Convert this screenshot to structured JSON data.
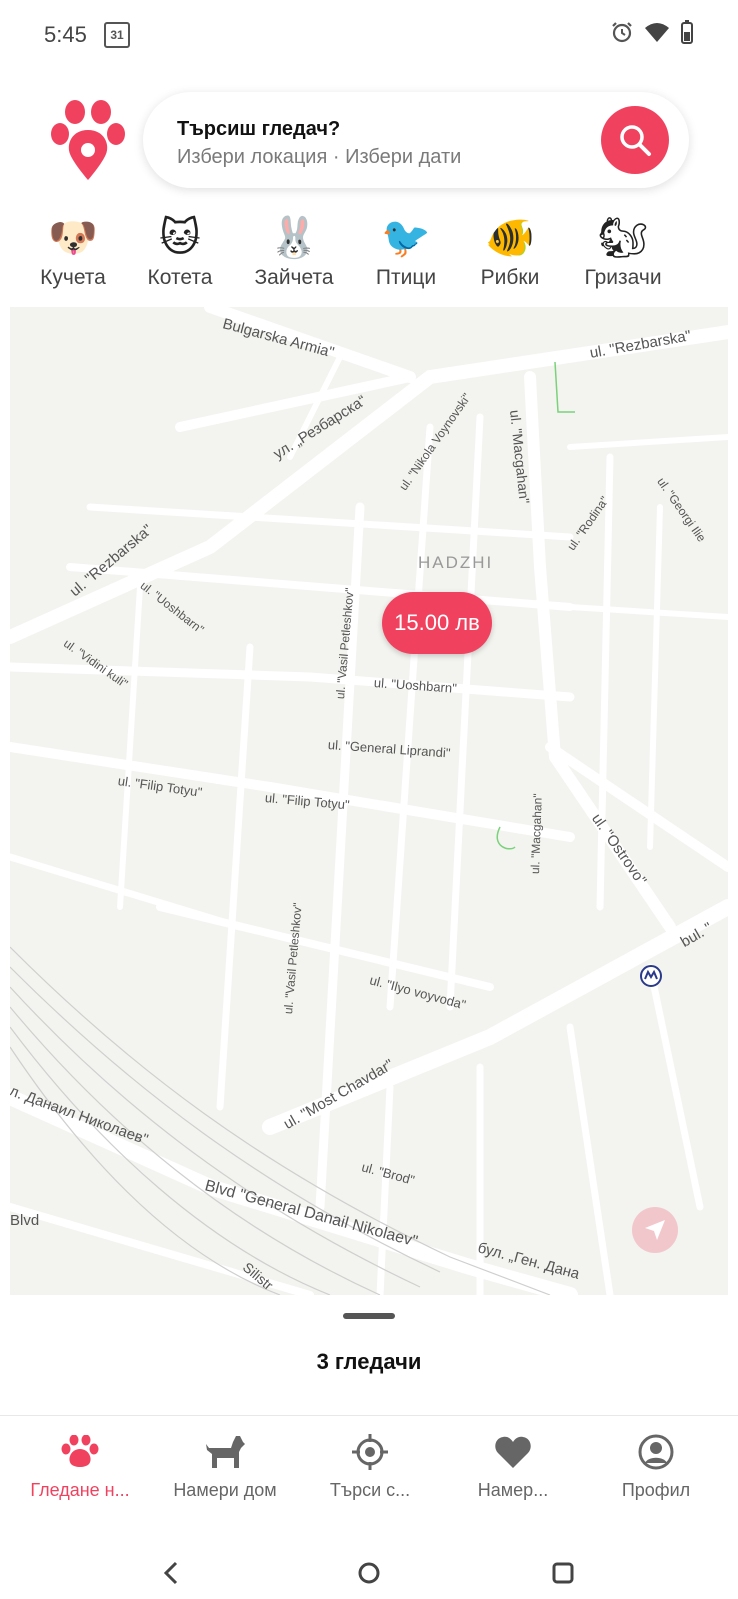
{
  "status_bar": {
    "time": "5:45",
    "calendar_day": "31"
  },
  "search": {
    "title": "Търсиш гледач?",
    "subtitle": "Избери локация · Избери дати"
  },
  "categories": [
    {
      "label": "Кучета",
      "emoji": "🐶",
      "icon": "dog-icon"
    },
    {
      "label": "Котета",
      "emoji": "🐱",
      "icon": "cat-icon"
    },
    {
      "label": "Зайчета",
      "emoji": "🐰",
      "icon": "rabbit-icon"
    },
    {
      "label": "Птици",
      "emoji": "🐦",
      "icon": "bird-icon"
    },
    {
      "label": "Рибки",
      "emoji": "🐠",
      "icon": "fish-icon"
    },
    {
      "label": "Гризачи",
      "emoji": "🐿",
      "icon": "rodent-icon"
    }
  ],
  "map": {
    "price_pin": "15.00 лв",
    "district": "HADZHI",
    "streets": [
      "Bulgarska Armia\"",
      "ul. \"Rezbarska\"",
      "ул. „Резбарска“",
      "ul. \"Nikola Voynovski\"",
      "ul. \"Macgahan\"",
      "ul. \"Rodina\"",
      "ul. \"Georgi Ilie",
      "ul. \"Rezbarska\"",
      "ul. \"Uoshbarn\"",
      "ul. \"Vidini kuli\"",
      "ul. \"Vasil Petleshkov\"",
      "ul. \"Uoshbarn\"",
      "ul. \"General Liprandi\"",
      "ul. \"Filip Totyu\"",
      "ul. \"Filip Totyu\"",
      "ul. \"Ostrovo\"",
      "ul. \"Macgahan\"",
      "bul. \"",
      "ul. \"Vasil Petleshkov\"",
      "ul. \"Ilyo voyvoda\"",
      "ul. \"Most Chavdar\"",
      "л. Данаил Николаев\"",
      "ul. \"Brod\"",
      "Blvd \"General Danail Nikolaev\"",
      "Blvd",
      "бул. „Ген. Дана",
      "Silistr"
    ]
  },
  "sheet": {
    "title": "3 гледачи"
  },
  "nav": [
    {
      "label": "Гледане н...",
      "icon": "paw-icon",
      "active": true
    },
    {
      "label": "Намери дом",
      "icon": "dog-silhouette-icon",
      "active": false
    },
    {
      "label": "Търси с...",
      "icon": "crosshair-icon",
      "active": false
    },
    {
      "label": "Намер...",
      "icon": "heart-icon",
      "active": false
    },
    {
      "label": "Профил",
      "icon": "profile-icon",
      "active": false
    }
  ],
  "colors": {
    "accent": "#f0425f",
    "map_bg": "#f3f3ef",
    "road": "#ffffff"
  }
}
